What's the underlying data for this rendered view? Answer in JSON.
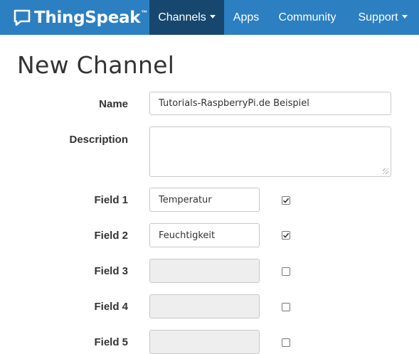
{
  "nav": {
    "brand": "ThingSpeak",
    "brand_tm": "™",
    "items": [
      {
        "label": "Channels",
        "dropdown": true,
        "active": true
      },
      {
        "label": "Apps",
        "dropdown": false,
        "active": false
      },
      {
        "label": "Community",
        "dropdown": false,
        "active": false
      },
      {
        "label": "Support",
        "dropdown": true,
        "active": false
      }
    ]
  },
  "page": {
    "title": "New Channel"
  },
  "form": {
    "name": {
      "label": "Name",
      "value": "Tutorials-RaspberryPi.de Beispiel"
    },
    "description": {
      "label": "Description",
      "value": ""
    },
    "fields": [
      {
        "label": "Field 1",
        "value": "Temperatur",
        "checked": true
      },
      {
        "label": "Field 2",
        "value": "Feuchtigkeit",
        "checked": true
      },
      {
        "label": "Field 3",
        "value": "",
        "checked": false
      },
      {
        "label": "Field 4",
        "value": "",
        "checked": false
      },
      {
        "label": "Field 5",
        "value": "",
        "checked": false
      }
    ]
  },
  "colors": {
    "navbar": "#2c7fc1",
    "nav_active": "#17476e",
    "disabled_input": "#eeeeee"
  }
}
